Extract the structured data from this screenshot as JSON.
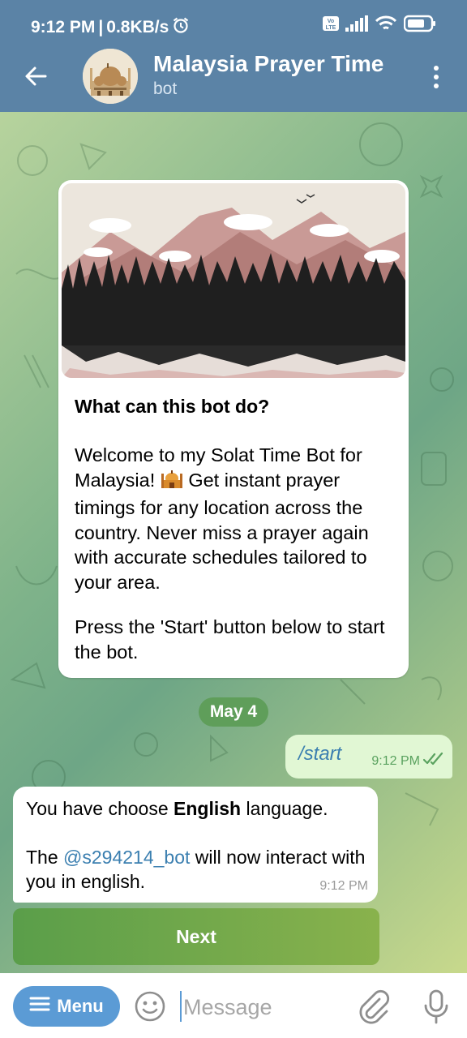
{
  "status_bar": {
    "time": "9:12 PM",
    "network_speed": "0.8KB/s",
    "alarm_icon": "alarm-icon",
    "volte_badge": "Vo LTE",
    "battery_icon": "battery-icon"
  },
  "header": {
    "title": "Malaysia Prayer Time",
    "subtitle": "bot",
    "back_icon": "arrow-left-icon",
    "more_icon": "more-vertical-icon"
  },
  "intro": {
    "heading": "What can this bot do?",
    "paragraph1_before_emoji": "Welcome to my Solat Time Bot for Malaysia!",
    "emoji": "mosque-emoji",
    "paragraph1_after_emoji": "Get instant prayer timings for any location across the country. Never miss a prayer again with accurate schedules tailored to your area.",
    "paragraph2": "Press the 'Start' button below to start the bot."
  },
  "date_chip": "May 4",
  "outgoing": {
    "text": "/start",
    "time": "9:12 PM"
  },
  "incoming": {
    "line1_prefix": "You have choose ",
    "line1_bold": "English",
    "line1_suffix": " language.",
    "line2_prefix": "The ",
    "line2_link": "@s294214_bot",
    "line2_suffix": " will now interact with you in english.",
    "time": "9:12 PM"
  },
  "keyboard_button": "Next",
  "composer": {
    "menu_label": "Menu",
    "placeholder": "Message"
  },
  "colors": {
    "header_bg": "#5b83a6",
    "accent_blue": "#5b9bd5",
    "outgoing_bubble": "#e1f7d4",
    "date_chip": "#5f9e5a"
  }
}
